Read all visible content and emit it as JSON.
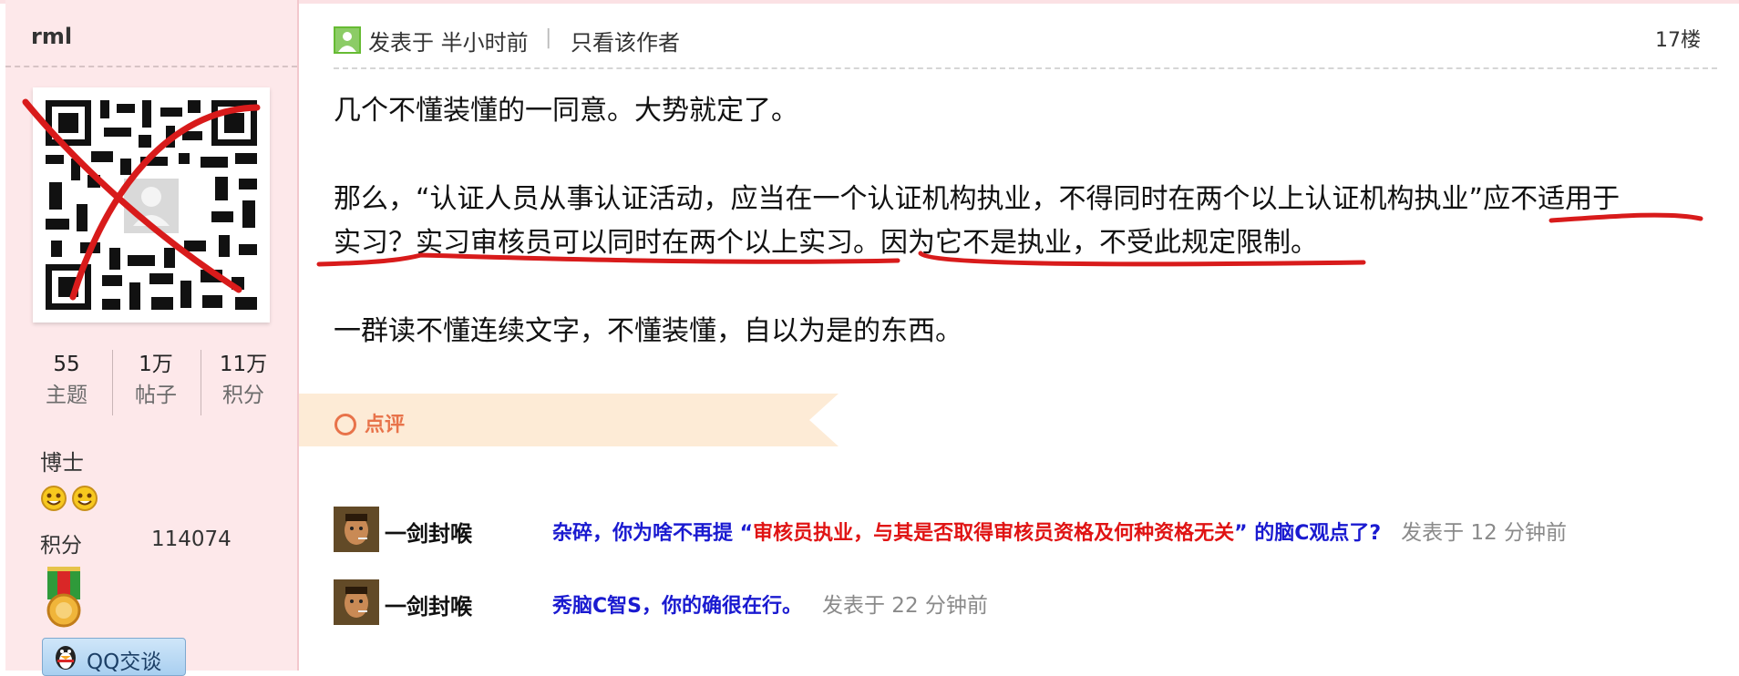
{
  "sidebar": {
    "author_name": "rml",
    "stats": [
      {
        "value": "55",
        "label": "主题"
      },
      {
        "value": "1万",
        "label": "帖子"
      },
      {
        "value": "11万",
        "label": "积分"
      }
    ],
    "rank_title": "博士",
    "score_label": "积分",
    "score_value": "114074",
    "qq_button_label": "QQ交谈"
  },
  "post": {
    "posted_label": "发表于 半小时前",
    "separator": "|",
    "only_author_label": "只看该作者",
    "floor": "17楼",
    "paragraphs": {
      "p1": "几个不懂装懂的一同意。大势就定了。",
      "p2_line1": "那么，“认证人员从事认证活动，应当在一个认证机构执业，不得同时在两个以上认证机构执业”应不适用于",
      "p2_line2": "实习？实习审核员可以同时在两个以上实习。因为它不是执业，不受此规定限制。",
      "p3": "一群读不懂连续文字，不懂装懂，自以为是的东西。"
    }
  },
  "comments": {
    "title": "点评",
    "items": [
      {
        "user": "一剑封喉",
        "text_a": "杂碎，你为啥不再提 “",
        "text_b": "审核员执业，与其是否取得审核员资格及何种资格无关",
        "text_c": "” 的脑C观点了?",
        "time": "发表于 12 分钟前"
      },
      {
        "user": "一剑封喉",
        "text_a": "秀脑C智S，你的确很在行。",
        "time": "发表于 22 分钟前"
      }
    ]
  },
  "colors": {
    "sidebar_bg": "#fde8ea",
    "comment_accent": "#e8734a",
    "comment_blue": "#1a1ad0",
    "comment_red": "#e01414",
    "annotation_red": "#d81b1b"
  }
}
